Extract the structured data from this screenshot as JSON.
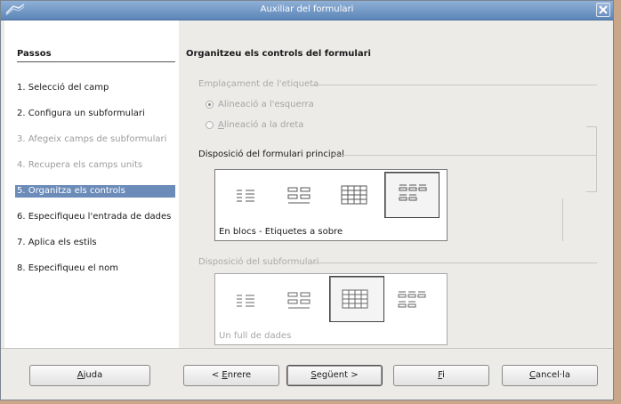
{
  "window": {
    "title": "Auxiliar del formulari"
  },
  "sidebar": {
    "heading": "Passos",
    "steps": [
      {
        "label": "1. Selecció del camp",
        "state": "normal"
      },
      {
        "label": "2. Configura un subformulari",
        "state": "normal"
      },
      {
        "label": "3. Afegeix camps de subformulari",
        "state": "disabled"
      },
      {
        "label": "4. Recupera els camps units",
        "state": "disabled"
      },
      {
        "label": "5. Organitza els controls",
        "state": "active"
      },
      {
        "label": "6. Especifiqueu l'entrada de dades",
        "state": "normal"
      },
      {
        "label": "7. Aplica els estils",
        "state": "normal"
      },
      {
        "label": "8. Especifiqueu el nom",
        "state": "normal"
      }
    ]
  },
  "main": {
    "heading": "Organitzeu els controls del formulari",
    "label_placement": {
      "title": "Emplaçament de l'etiqueta",
      "left": "Alineació a l'esquerra",
      "right_prefix": "",
      "right_mnemonic": "A",
      "right_rest": "lineació a la dreta"
    },
    "main_layout": {
      "title": "Disposició del formulari principal",
      "caption": "En blocs - Etiquetes a sobre",
      "selected": 3
    },
    "sub_layout": {
      "title": "Disposició del subformulari",
      "caption": "Un full de dades",
      "selected": 2
    }
  },
  "buttons": {
    "help": {
      "mn": "A",
      "rest": "juda"
    },
    "back": {
      "pre": "< ",
      "mn": "E",
      "rest": "nrere"
    },
    "next": {
      "mn": "S",
      "rest": "egüent >"
    },
    "finish": {
      "mn": "F",
      "rest": "i"
    },
    "cancel": {
      "mn": "C",
      "rest": "ancel·la"
    }
  },
  "colors": {
    "title_bar": "#6d93c4",
    "selection": "#6b8bb8",
    "window_bg": "#edebe8"
  }
}
